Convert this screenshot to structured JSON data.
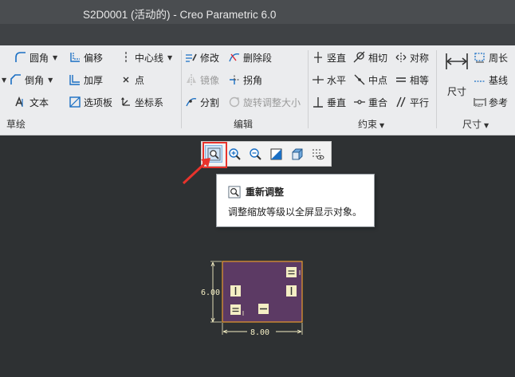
{
  "window": {
    "title": "S2D0001 (活动的) - Creo Parametric 6.0"
  },
  "ribbon": {
    "sketch_group": {
      "label": "草绘",
      "items": {
        "fillet": "圆角",
        "offset": "偏移",
        "centerline": "中心线",
        "chamfer": "倒角",
        "thicken": "加厚",
        "point": "点",
        "text": "文本",
        "palette": "选项板",
        "coord_sys": "坐标系"
      }
    },
    "edit_group": {
      "label": "编辑",
      "items": {
        "modify": "修改",
        "delete_segment": "删除段",
        "mirror": "镜像",
        "corner": "拐角",
        "divide": "分割",
        "rotate_resize": "旋转调整大小"
      }
    },
    "constraint_group": {
      "label": "约束",
      "items": {
        "vertical": "竖直",
        "tangent": "相切",
        "symmetric": "对称",
        "horizontal": "水平",
        "midpoint": "中点",
        "equal": "相等",
        "perpendicular": "垂直",
        "coincident": "重合",
        "parallel": "平行"
      }
    },
    "dimension_group": {
      "label": "尺寸",
      "items": {
        "dimension": "尺寸",
        "perimeter": "周长",
        "baseline": "基线",
        "reference": "参考"
      }
    }
  },
  "view_toolbar": {
    "buttons": [
      "refit-icon",
      "zoom-in-icon",
      "zoom-out-icon",
      "repaint-icon",
      "display-style-icon",
      "sketcher-display-icon"
    ]
  },
  "tooltip": {
    "title": "重新调整",
    "description": "调整缩放等级以全屏显示对象。"
  },
  "sketch": {
    "dim_height": "6.00",
    "dim_width": "8.00"
  },
  "colors": {
    "accent_red": "#e8332c",
    "sketch_fill": "#5c3a64",
    "sketch_edge": "#e89a2e",
    "dim_color": "#f4eec4",
    "background": "#2e3133"
  }
}
